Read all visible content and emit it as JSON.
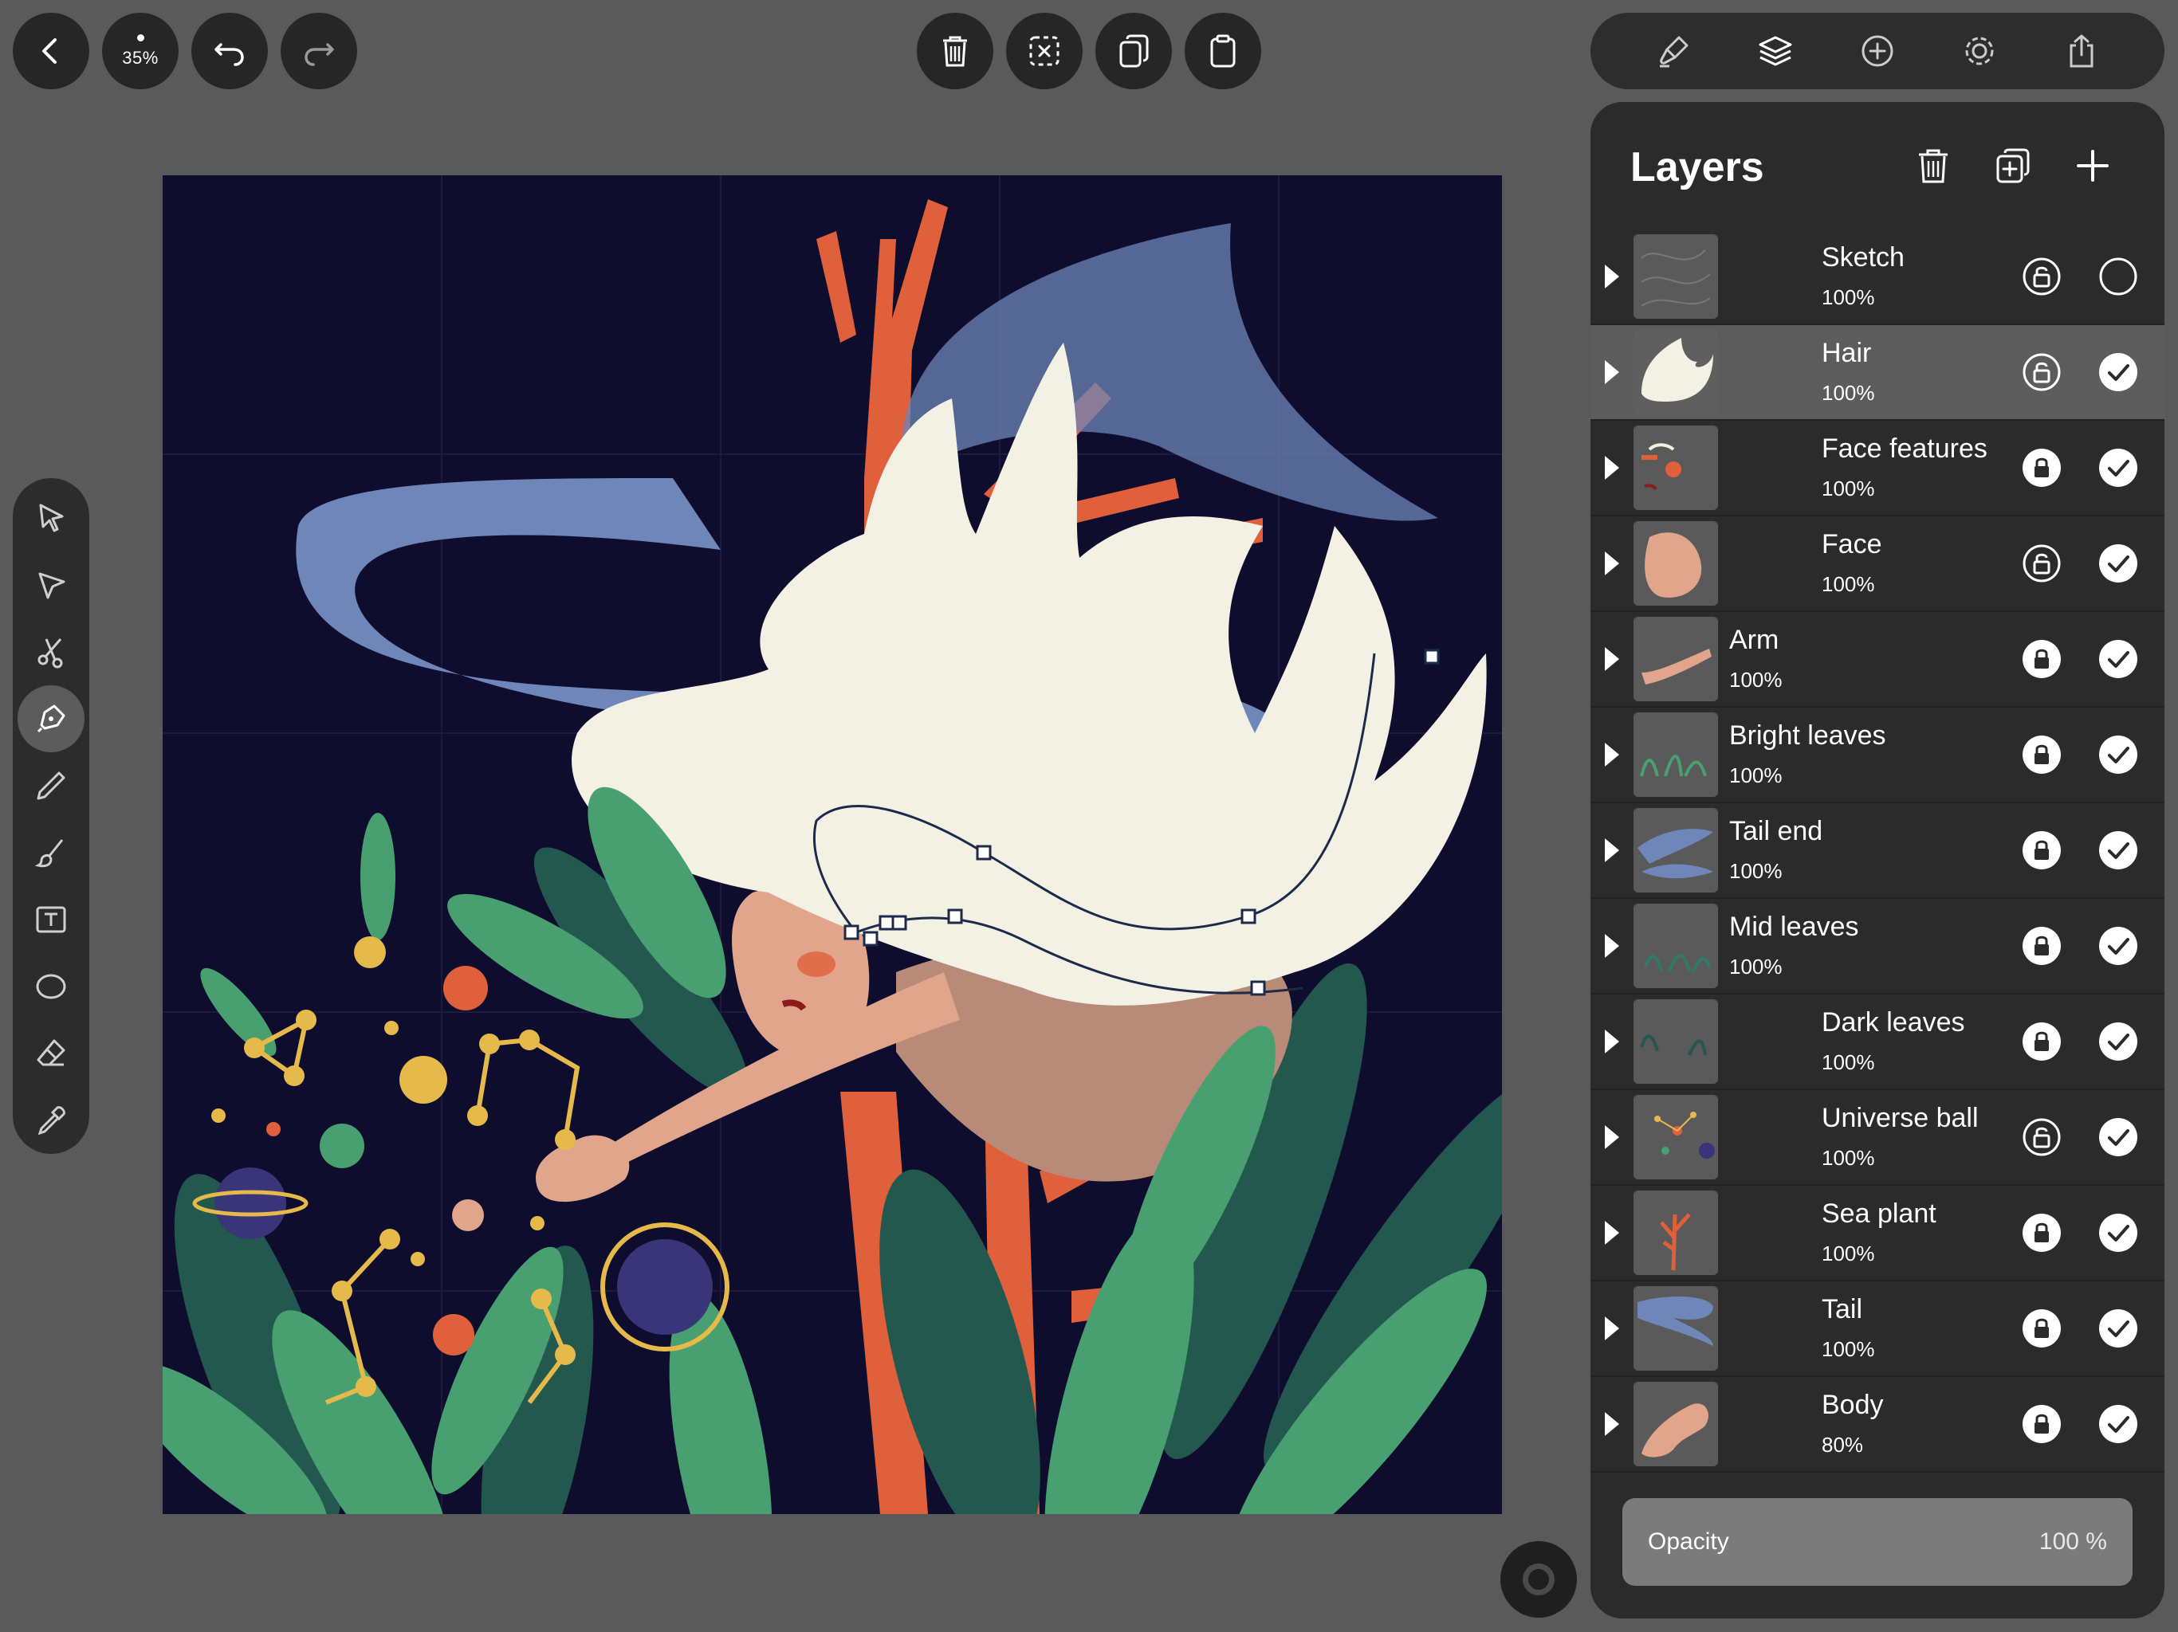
{
  "toolbar": {
    "zoom_label": "35%",
    "icons": [
      "back-icon",
      "undo-icon",
      "redo-icon",
      "delete-icon",
      "deselect-icon",
      "duplicate-icon",
      "clipboard-icon"
    ]
  },
  "top_right_icons": [
    "brush-settings-icon",
    "layers-icon",
    "add-icon",
    "settings-icon",
    "share-icon"
  ],
  "tools": [
    "selection-arrow-icon",
    "direct-select-icon",
    "scissors-icon",
    "pen-icon",
    "pencil-icon",
    "brush-icon",
    "text-icon",
    "ellipse-icon",
    "eraser-icon",
    "eyedropper-icon"
  ],
  "active_tool": "pen-icon",
  "layers_panel": {
    "title": "Layers",
    "header_icons": [
      "trash-icon",
      "duplicate-layer-icon",
      "plus-icon"
    ],
    "layers": [
      {
        "name": "Sketch",
        "opacity": "100%",
        "locked": false,
        "visible": false,
        "selected": false,
        "indent": true
      },
      {
        "name": "Hair",
        "opacity": "100%",
        "locked": false,
        "visible": true,
        "selected": true,
        "indent": true
      },
      {
        "name": "Face features",
        "opacity": "100%",
        "locked": true,
        "visible": true,
        "selected": false,
        "indent": true
      },
      {
        "name": "Face",
        "opacity": "100%",
        "locked": false,
        "visible": true,
        "selected": false,
        "indent": true
      },
      {
        "name": "Arm",
        "opacity": "100%",
        "locked": true,
        "visible": true,
        "selected": false,
        "indent": false
      },
      {
        "name": "Bright leaves",
        "opacity": "100%",
        "locked": true,
        "visible": true,
        "selected": false,
        "indent": false
      },
      {
        "name": "Tail end",
        "opacity": "100%",
        "locked": true,
        "visible": true,
        "selected": false,
        "indent": false
      },
      {
        "name": "Mid leaves",
        "opacity": "100%",
        "locked": true,
        "visible": true,
        "selected": false,
        "indent": false
      },
      {
        "name": "Dark leaves",
        "opacity": "100%",
        "locked": true,
        "visible": true,
        "selected": false,
        "indent": true
      },
      {
        "name": "Universe ball",
        "opacity": "100%",
        "locked": false,
        "visible": true,
        "selected": false,
        "indent": true
      },
      {
        "name": "Sea plant",
        "opacity": "100%",
        "locked": true,
        "visible": true,
        "selected": false,
        "indent": true
      },
      {
        "name": "Tail",
        "opacity": "100%",
        "locked": true,
        "visible": true,
        "selected": false,
        "indent": true
      },
      {
        "name": "Body",
        "opacity": "80%",
        "locked": true,
        "visible": true,
        "selected": false,
        "indent": true
      }
    ],
    "opacity_label": "Opacity",
    "opacity_value": "100 %"
  },
  "colors": {
    "canvas_bg": "#0e0d2e",
    "hair": "#f2f1e4",
    "tail": "#6e86b8",
    "coral": "#e0603b",
    "leaf_light": "#48a070",
    "leaf_dark": "#23584e",
    "skin": "#e0a58a",
    "body": "#b88a78",
    "gold": "#e6b94b"
  }
}
